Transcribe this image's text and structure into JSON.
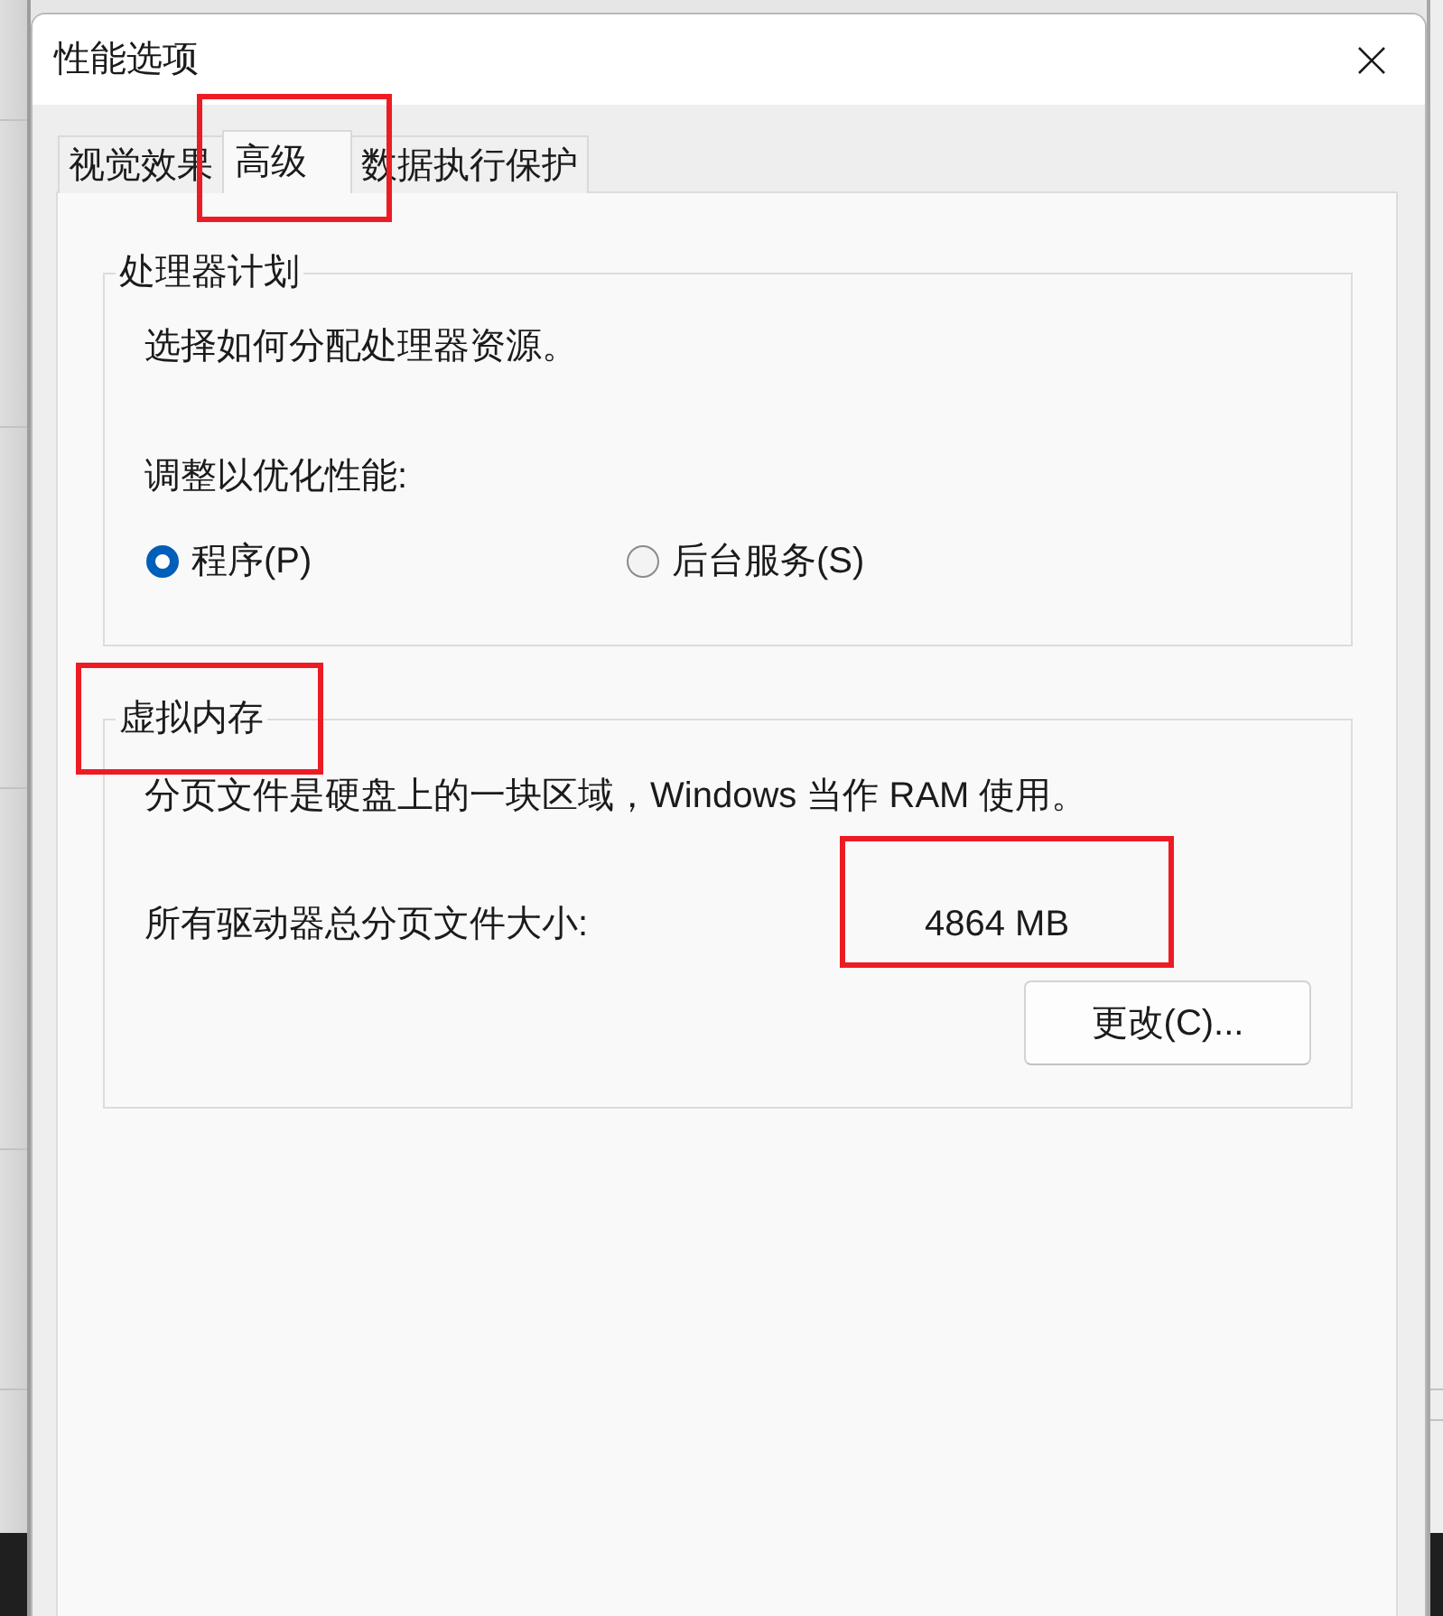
{
  "window": {
    "title": "性能选项"
  },
  "tabs": [
    {
      "label": "视觉效果",
      "selected": false,
      "highlighted": false
    },
    {
      "label": "高级",
      "selected": true,
      "highlighted": true
    },
    {
      "label": "数据执行保护",
      "selected": false,
      "highlighted": false
    }
  ],
  "processor_scheduling": {
    "title": "处理器计划",
    "description": "选择如何分配处理器资源。",
    "prompt": "调整以优化性能:",
    "options": [
      {
        "label": "程序(P)",
        "selected": true
      },
      {
        "label": "后台服务(S)",
        "selected": false
      }
    ]
  },
  "virtual_memory": {
    "title": "虚拟内存",
    "title_highlighted": true,
    "description": "分页文件是硬盘上的一块区域，Windows 当作 RAM 使用。",
    "size_label": "所有驱动器总分页文件大小:",
    "size_value": "4864 MB",
    "size_highlighted": true,
    "change_button": "更改(C)..."
  }
}
